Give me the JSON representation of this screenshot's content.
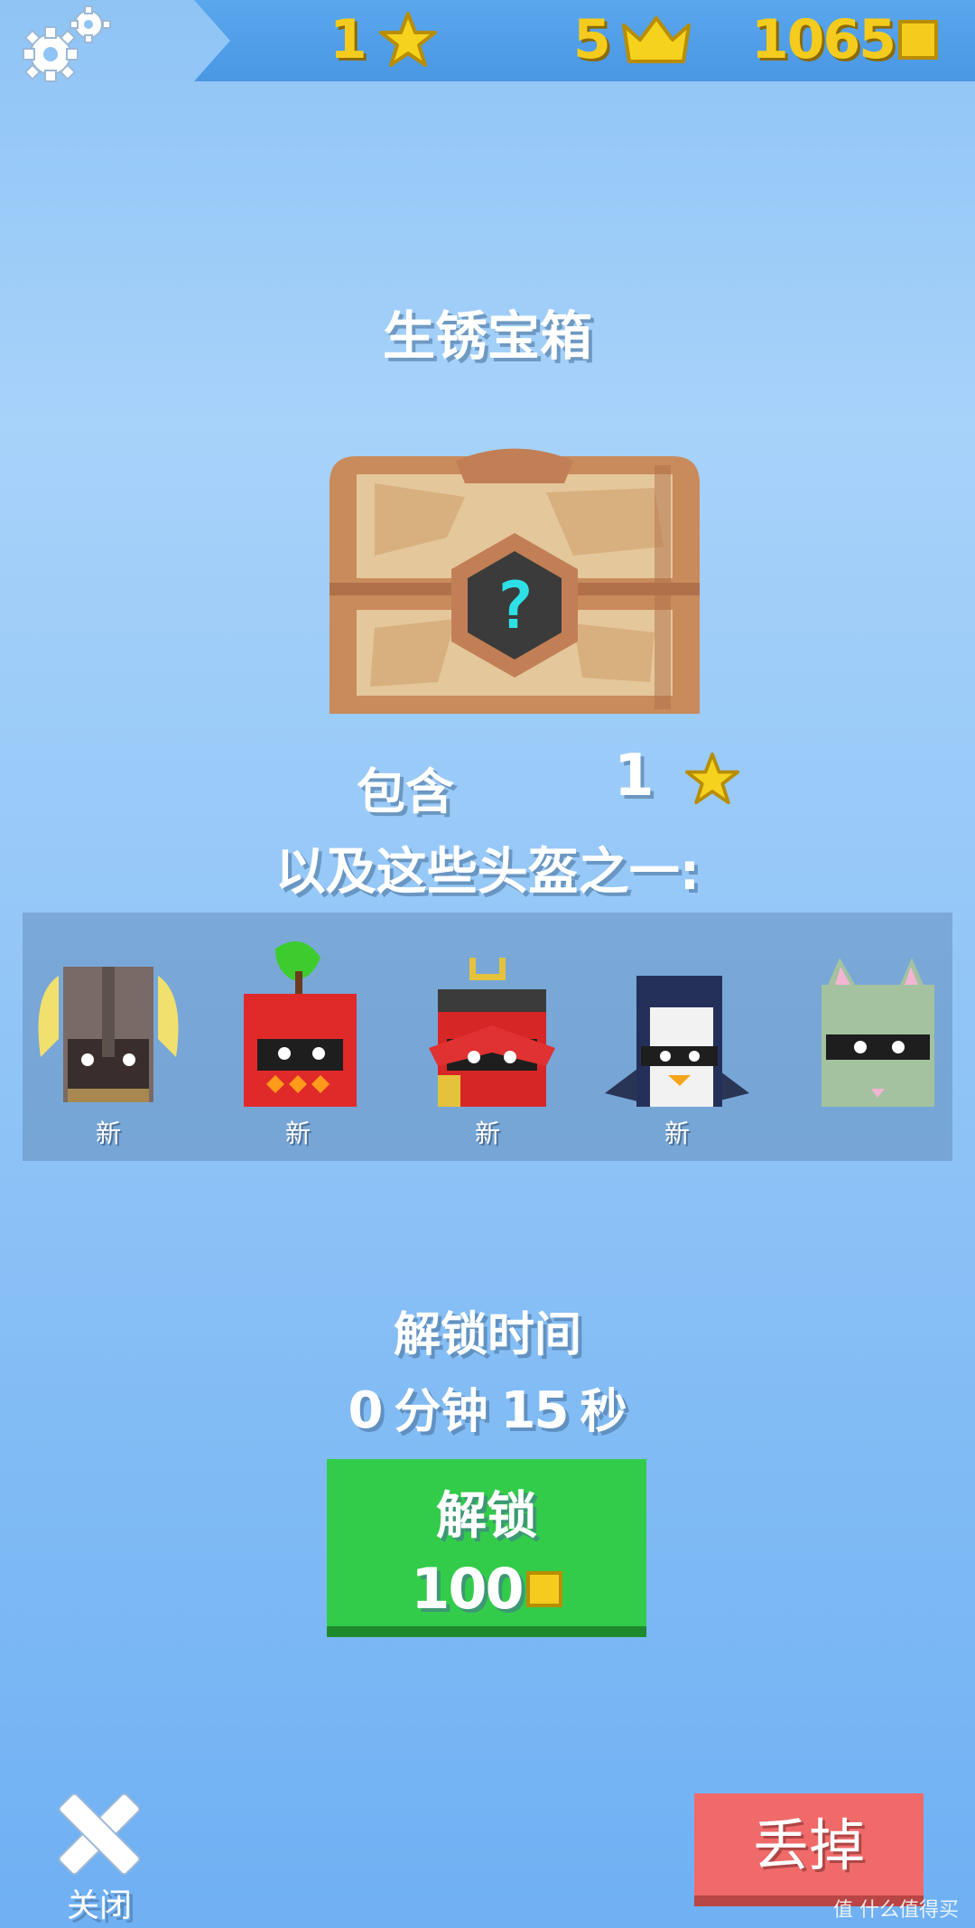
{
  "top_bar": {
    "stars": "1",
    "crowns": "5",
    "coins": "1065"
  },
  "chest": {
    "title": "生锈宝箱",
    "contains_label": "包含",
    "contains_stars": "1",
    "helmets_label": "以及这些头盔之一:"
  },
  "helmets": [
    {
      "name": "viking-helmet",
      "badge": "新"
    },
    {
      "name": "apple-helmet",
      "badge": "新"
    },
    {
      "name": "samurai-helmet",
      "badge": "新"
    },
    {
      "name": "penguin-helmet",
      "badge": "新"
    },
    {
      "name": "cat-helmet",
      "badge": ""
    }
  ],
  "unlock": {
    "time_label": "解锁时间",
    "minutes": "0",
    "minutes_unit": "分钟",
    "seconds": "15",
    "seconds_unit": "秒",
    "button_label": "解锁",
    "cost": "100"
  },
  "footer": {
    "close_label": "关闭",
    "discard_label": "丢掉",
    "watermark": "值 什么值得买"
  },
  "colors": {
    "background": "#8fc4f5",
    "gold": "#f5cc1d",
    "unlock_green": "#33cc4a",
    "discard_red": "#f06a6a"
  }
}
